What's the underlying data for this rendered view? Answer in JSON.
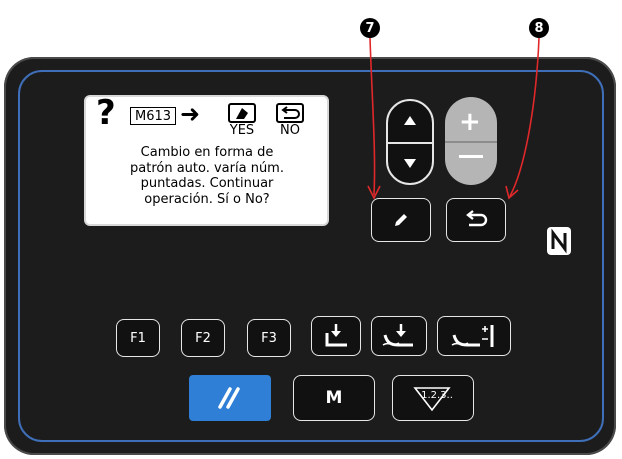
{
  "callouts": {
    "seven": "7",
    "eight": "8"
  },
  "lcd": {
    "question_mark": "?",
    "mode_code": "M613",
    "yes_label": "YES",
    "no_label": "NO",
    "message": "Cambio en forma de\npatrón auto. varía núm.\npuntadas. Continuar\noperación. Sí o No?"
  },
  "buttons": {
    "f1": "F1",
    "f2": "F2",
    "f3": "F3",
    "m": "M",
    "counter": "1.2.3.."
  },
  "icons": {
    "up": "up-arrow-icon",
    "down": "down-arrow-icon",
    "plus": "plus-icon",
    "minus": "minus-icon",
    "pencil": "pencil-icon",
    "return": "return-icon",
    "nfc": "nfc-icon",
    "presser_foot": "presser-foot-icon",
    "thread_trim": "thread-trim-icon",
    "thread_tension": "thread-tension-icon",
    "reset": "reset-icon"
  },
  "colors": {
    "panel": "#1c1c1c",
    "accent_blue": "#2f7fd6",
    "callout_red": "#e0282a",
    "plus_minus_grey": "#b5b5b5"
  }
}
